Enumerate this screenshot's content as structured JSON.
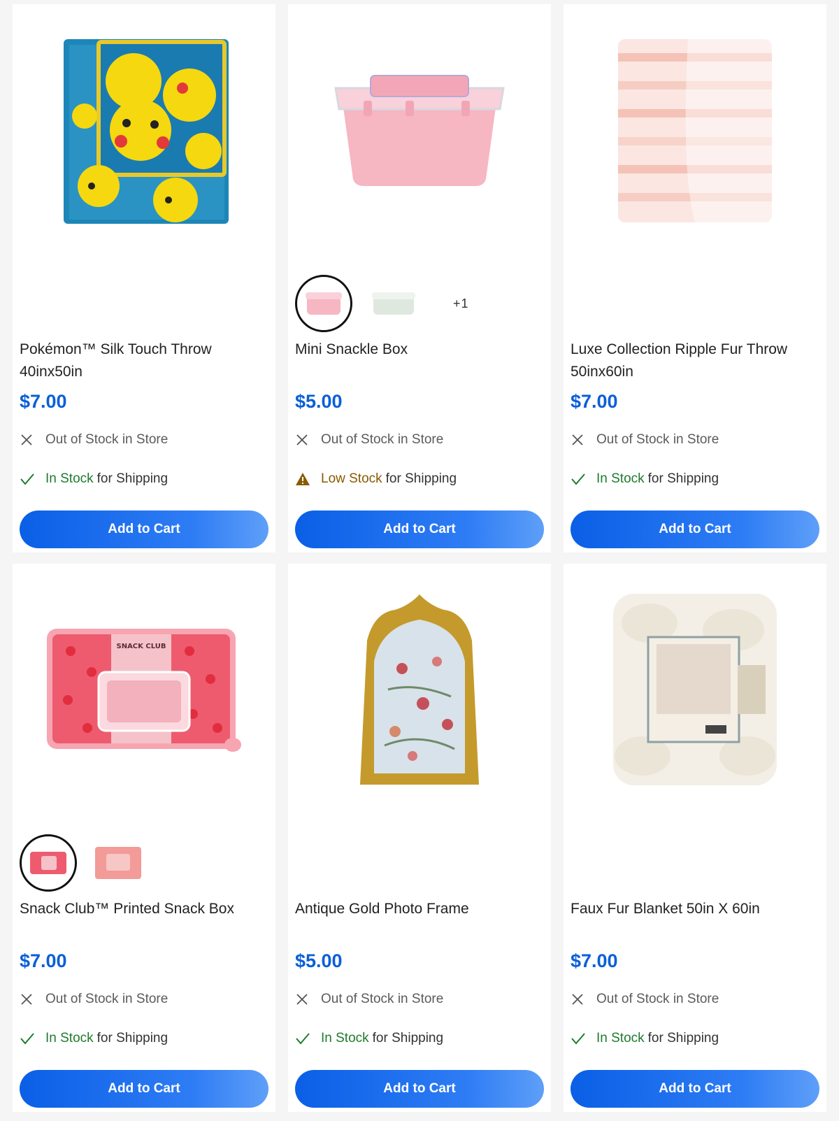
{
  "theme": {
    "accent": "#0a5fe6",
    "price_color": "#0a5fd8",
    "in_stock_color": "#1e7b2d",
    "low_stock_color": "#8a5a00",
    "out_of_stock_color": "#5b5b5b"
  },
  "products": [
    {
      "title": "Pokémon™ Silk Touch Throw 40inx50in",
      "price": "$7.00",
      "image_icon": "pokemon-throw-blanket-image",
      "store_status": "Out of Stock in Store",
      "store_icon": "x-icon",
      "shipping_status": "In Stock",
      "shipping_suffix": "for Shipping",
      "shipping_icon": "check-icon",
      "cart_label": "Add to Cart"
    },
    {
      "title": "Mini Snackle Box",
      "price": "$5.00",
      "image_icon": "snack-container-image",
      "swatches": [
        "pink",
        "clear"
      ],
      "swatches_more": "+1",
      "store_status": "Out of Stock in Store",
      "store_icon": "x-icon",
      "shipping_status": "Low Stock",
      "shipping_suffix": "for Shipping",
      "shipping_icon": "warning-icon",
      "cart_label": "Add to Cart"
    },
    {
      "title": "Luxe Collection Ripple Fur Throw 50inx60in",
      "price": "$7.00",
      "image_icon": "ripple-fur-throw-image",
      "store_status": "Out of Stock in Store",
      "store_icon": "x-icon",
      "shipping_status": "In Stock",
      "shipping_suffix": "for Shipping",
      "shipping_icon": "check-icon",
      "cart_label": "Add to Cart"
    },
    {
      "title": "Snack Club™ Printed Snack Box",
      "price": "$7.00",
      "image_icon": "strawberry-snack-box-image",
      "swatches": [
        "light-pink",
        "pink"
      ],
      "store_status": "Out of Stock in Store",
      "store_icon": "x-icon",
      "shipping_status": "In Stock",
      "shipping_suffix": "for Shipping",
      "shipping_icon": "check-icon",
      "cart_label": "Add to Cart"
    },
    {
      "title": "Antique Gold Photo Frame",
      "price": "$5.00",
      "image_icon": "gold-photo-frame-image",
      "store_status": "Out of Stock in Store",
      "store_icon": "x-icon",
      "shipping_status": "In Stock",
      "shipping_suffix": "for Shipping",
      "shipping_icon": "check-icon",
      "cart_label": "Add to Cart"
    },
    {
      "title": "Faux Fur Blanket 50in X 60in",
      "price": "$7.00",
      "image_icon": "faux-fur-blanket-image",
      "store_status": "Out of Stock in Store",
      "store_icon": "x-icon",
      "shipping_status": "In Stock",
      "shipping_suffix": "for Shipping",
      "shipping_icon": "check-icon",
      "cart_label": "Add to Cart"
    }
  ]
}
